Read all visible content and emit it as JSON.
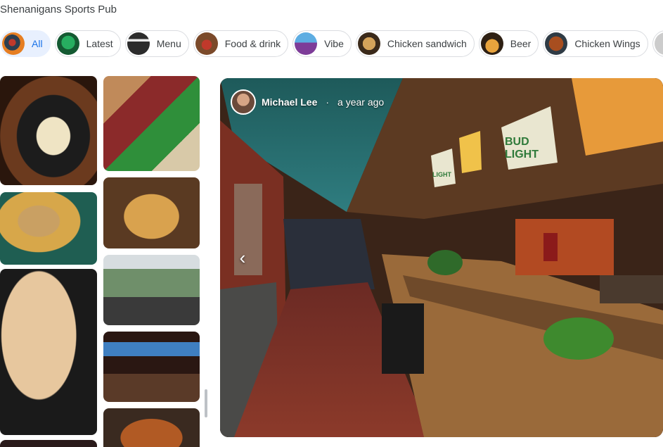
{
  "place": {
    "name": "Shenanigans Sports Pub"
  },
  "chips": [
    {
      "label": "All",
      "active": true,
      "thumb": "radial-gradient(circle at 45% 45%, #c0392b 0 20%, #2c3e50 21% 45%, #e67e22 46%)"
    },
    {
      "label": "Latest",
      "active": false,
      "thumb": "radial-gradient(circle at 50% 45%, #27ae60 0 40%, #145a32 41%)"
    },
    {
      "label": "Menu",
      "active": false,
      "thumb": "linear-gradient(#2c2c2c 0 30%, #eaeaea 30% 40%, #2c2c2c 40% 100%)"
    },
    {
      "label": "Food & drink",
      "active": false,
      "thumb": "radial-gradient(circle at 50% 55%, #c0392b 0 30%, #7b4a2a 31%)"
    },
    {
      "label": "Vibe",
      "active": false,
      "thumb": "linear-gradient(#5dade2 0 45%, #7d3c98 45%)"
    },
    {
      "label": "Chicken sandwich",
      "active": false,
      "thumb": "radial-gradient(circle at 50% 50%, #d4a35a 0 40%, #3b2a1a 41%)"
    },
    {
      "label": "Beer",
      "active": false,
      "thumb": "radial-gradient(circle at 50% 60%, #e8a33d 0 38%, #2e2014 39%)"
    },
    {
      "label": "Chicken Wings",
      "active": false,
      "thumb": "radial-gradient(circle at 50% 50%, #a84e1f 0 45%, #2f3b45 46%)"
    }
  ],
  "viewer": {
    "author": "Michael Lee",
    "separator": "·",
    "time": "a year ago",
    "banner1": "BUD",
    "banner2": "LIGHT",
    "pennant_text": "LIGHT"
  },
  "icons": {
    "prev": "chevron-left-icon"
  }
}
